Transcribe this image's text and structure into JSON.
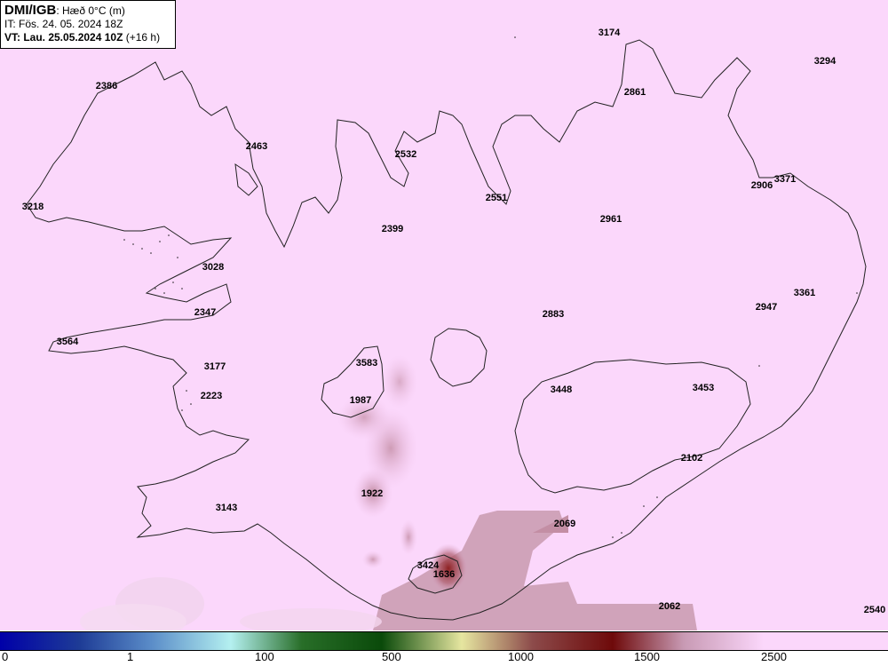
{
  "header": {
    "source": "DMI/IGB",
    "parameter": "Hæð 0°C (m)",
    "initial_time": "IT: Fös. 24. 05. 2024 18Z",
    "valid_time_bold": "VT: Lau. 25.05.2024 10Z",
    "valid_time_offset": "(+16 h)"
  },
  "labels": [
    {
      "text": "3174",
      "lon": 0.686
    },
    {
      "text": "3294"
    },
    {
      "text": "2386"
    },
    {
      "text": "2861"
    },
    {
      "text": "2463"
    },
    {
      "text": "2532"
    },
    {
      "text": "2906"
    },
    {
      "text": "3371"
    },
    {
      "text": "3218"
    },
    {
      "text": "2551"
    },
    {
      "text": "2961"
    },
    {
      "text": "2399"
    },
    {
      "text": "3028"
    },
    {
      "text": "3361"
    },
    {
      "text": "2947"
    },
    {
      "text": "2347"
    },
    {
      "text": "2883"
    },
    {
      "text": "3564"
    },
    {
      "text": "3583"
    },
    {
      "text": "3177"
    },
    {
      "text": "3448"
    },
    {
      "text": "3453"
    },
    {
      "text": "2223"
    },
    {
      "text": "1987"
    },
    {
      "text": "2102"
    },
    {
      "text": "1922"
    },
    {
      "text": "3143"
    },
    {
      "text": "2069"
    },
    {
      "text": "3424"
    },
    {
      "text": "1636"
    },
    {
      "text": "2062"
    },
    {
      "text": "2540"
    }
  ],
  "colorbar": {
    "ticks": [
      "0",
      "1",
      "100",
      "500",
      "1000",
      "1500",
      "2500"
    ],
    "colors": [
      "#0000a8",
      "#1e3c96",
      "#5a8cc8",
      "#b4f0f0",
      "#286e28",
      "#0a4a0a",
      "#e6e6a0",
      "#8c4a4a",
      "#6e0a0a",
      "#c89ab4",
      "#fbd7fb"
    ]
  }
}
